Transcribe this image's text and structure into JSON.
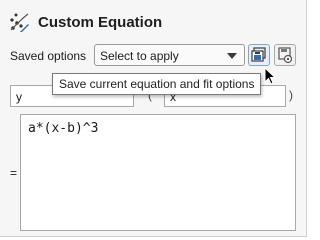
{
  "header": {
    "title": "Custom Equation",
    "icon": "custom-equation-icon"
  },
  "saved_options": {
    "label": "Saved options",
    "select_value": "Select to apply",
    "save_button_icon": "save-options-icon",
    "manage_button_icon": "manage-options-icon"
  },
  "tooltip": {
    "text": "Save current equation and fit options"
  },
  "variables": {
    "y_value": "y",
    "x_value": "x",
    "open_paren": "(",
    "close_paren": ")"
  },
  "equation": {
    "equals": "=",
    "value": "a*(x-b)^3"
  },
  "colors": {
    "accent_border": "#7fa7d6",
    "panel_background": "#f6f6f6"
  }
}
